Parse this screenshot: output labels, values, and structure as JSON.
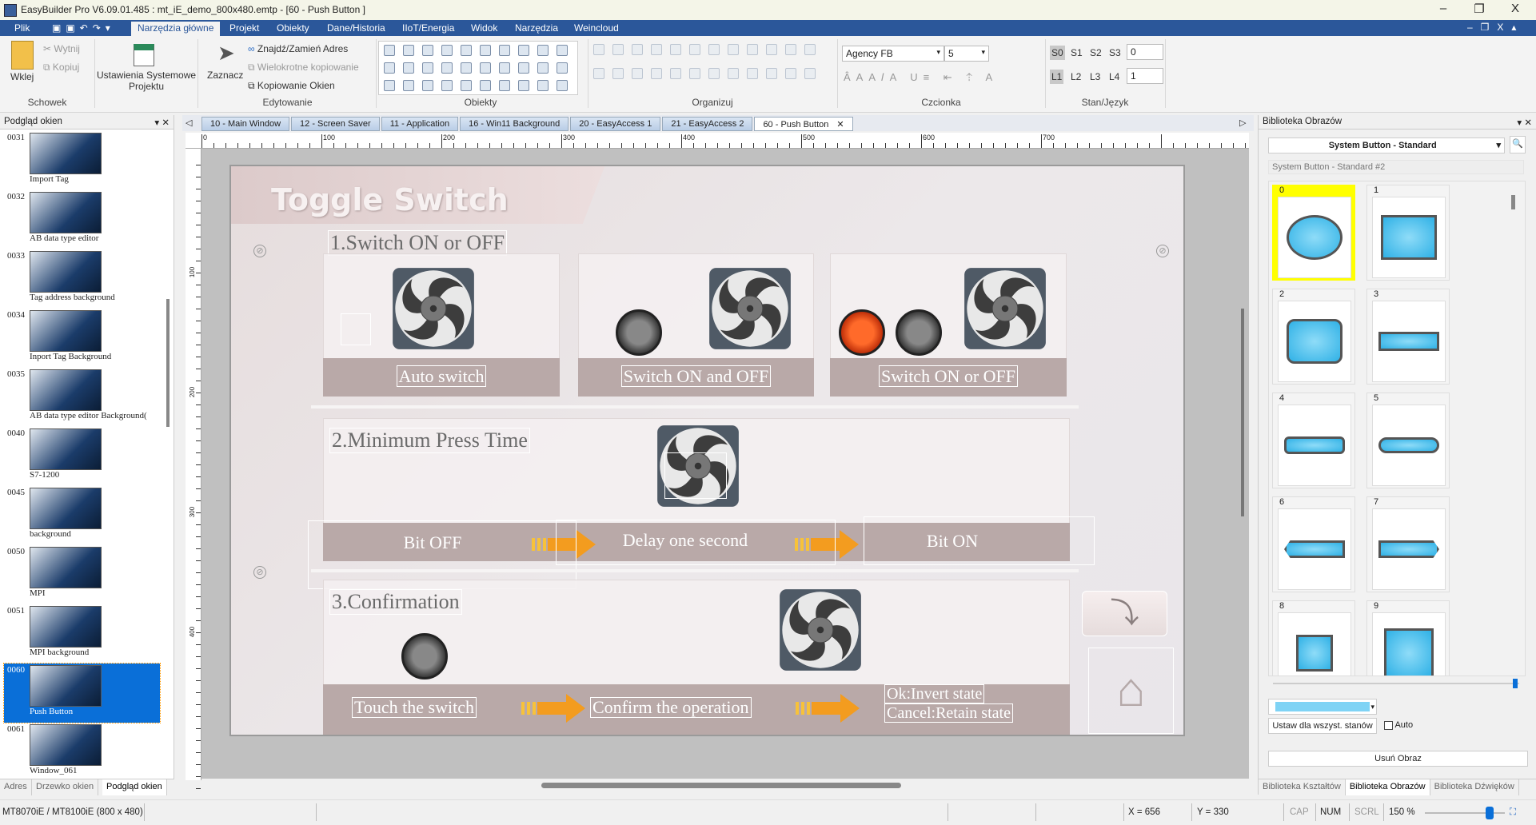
{
  "window": {
    "title": "EasyBuilder Pro V6.09.01.485 : mt_iE_demo_800x480.emtp - [60 - Push Button ]",
    "minimize": "–",
    "restore": "❐",
    "close": "X"
  },
  "menu": {
    "items": [
      "Plik",
      "Narzędzia główne",
      "Projekt",
      "Obiekty",
      "Dane/Historia",
      "IIoT/Energia",
      "Widok",
      "Narzędzia",
      "Weincloud"
    ],
    "active": "Narzędzia główne"
  },
  "ribbon": {
    "schowek": {
      "paste": "Wklej",
      "cut": "Wytnij",
      "copy": "Kopiuj",
      "label": "Schowek"
    },
    "settings": {
      "line1": "Ustawienia Systemowe",
      "line2": "Projektu"
    },
    "edit": {
      "select": "Zaznacz",
      "find": "Znajdź/Zamień Adres",
      "multicopy": "Wielokrotne kopiowanie",
      "copywin": "Kopiowanie Okien",
      "label": "Edytowanie"
    },
    "objects": {
      "label": "Obiekty"
    },
    "arrange": {
      "label": "Organizuj"
    },
    "font": {
      "family": "Agency FB",
      "size": "5",
      "label": "Czcionka"
    },
    "state": {
      "states": [
        "S0",
        "S1",
        "S2",
        "S3"
      ],
      "state_value": "0",
      "langs": [
        "L1",
        "L2",
        "L3",
        "L4"
      ],
      "lang_value": "1",
      "label": "Stan/Język"
    }
  },
  "left_panel": {
    "title": "Podgląd okien",
    "items": [
      {
        "num": "0031",
        "caption": "Import Tag"
      },
      {
        "num": "0032",
        "caption": "AB data type editor"
      },
      {
        "num": "0033",
        "caption": "Tag address background"
      },
      {
        "num": "0034",
        "caption": "Inport Tag Background"
      },
      {
        "num": "0035",
        "caption": "AB data type editor Background("
      },
      {
        "num": "0040",
        "caption": "S7-1200"
      },
      {
        "num": "0045",
        "caption": "background"
      },
      {
        "num": "0050",
        "caption": "MPI"
      },
      {
        "num": "0051",
        "caption": "MPI background"
      },
      {
        "num": "0060",
        "caption": "Push Button",
        "selected": true
      },
      {
        "num": "0061",
        "caption": "Window_061"
      }
    ],
    "tabs": [
      "Adres",
      "Drzewko okien",
      "Podgląd okien"
    ],
    "active_tab": "Podgląd okien"
  },
  "doc_tabs": {
    "items": [
      "10 - Main Window",
      "12 - Screen Saver",
      "11 - Application",
      "16 - Win11 Background",
      "20 - EasyAccess 1",
      "21 - EasyAccess 2",
      "60 - Push Button"
    ],
    "active": "60 - Push Button",
    "close": "✕"
  },
  "ruler": {
    "ticks": [
      "0",
      "100",
      "200",
      "300",
      "400",
      "500",
      "600",
      "700"
    ],
    "vticks": [
      "100",
      "200",
      "300",
      "400"
    ]
  },
  "screen": {
    "title": "Toggle Switch",
    "s1": {
      "label": "1.Switch ON or OFF",
      "items": [
        "Auto switch",
        "Switch ON and OFF",
        "Switch ON or OFF"
      ]
    },
    "s2": {
      "label": "2.Minimum Press Time",
      "steps": [
        "Bit OFF",
        "Delay one second",
        "Bit ON"
      ]
    },
    "s3": {
      "label": "3.Confirmation",
      "steps": [
        "Touch the switch",
        "Confirm the operation"
      ],
      "ok": "Ok:Invert state",
      "cancel": "Cancel:Retain state"
    },
    "colors": {
      "band": "#b9a9a8",
      "arrow": "#f39c1f",
      "power_on": "#e8501c"
    }
  },
  "right_panel": {
    "title": "Biblioteka Obrazów",
    "library": "System Button - Standard",
    "subtitle": "System Button - Standard #2",
    "cells": [
      "0",
      "1",
      "2",
      "3",
      "4",
      "5",
      "6",
      "7",
      "8",
      "9"
    ],
    "selected": "0",
    "set_all": "Ustaw dla wszyst. stanów",
    "auto": "Auto",
    "auto_checked": false,
    "remove": "Usuń Obraz",
    "color": "#7fd3f5",
    "tabs": [
      "Biblioteka Kształtów",
      "Biblioteka Obrazów",
      "Biblioteka Dźwięków"
    ],
    "active_tab": "Biblioteka Obrazów"
  },
  "status": {
    "model": "MT8070iE / MT8100iE (800 x 480)",
    "x": "X = 656",
    "y": "Y = 330",
    "cap": "CAP",
    "num": "NUM",
    "scrl": "SCRL",
    "zoom": "150 %"
  }
}
